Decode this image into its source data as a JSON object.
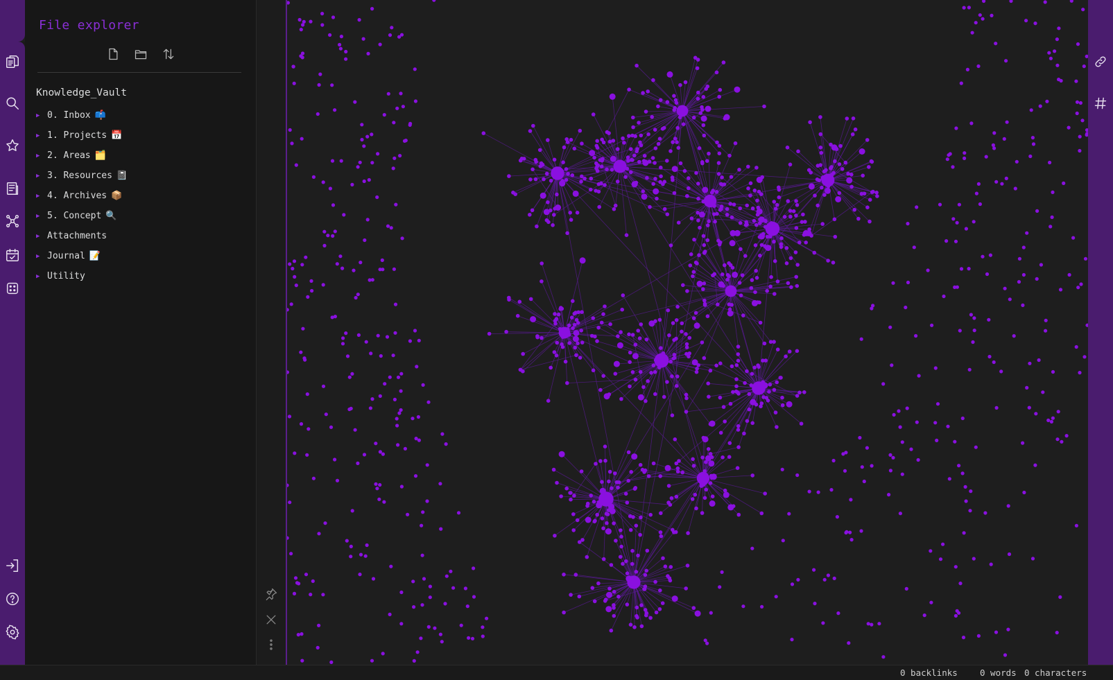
{
  "colors": {
    "accent": "#8a2fd6",
    "ribbon": "#4a1c6e",
    "node": "#8a10e0",
    "edge": "#5a1a96",
    "background": "#1e1e1e"
  },
  "ribbon_left": {
    "icons": [
      "file-explorer-icon",
      "search-icon",
      "starred-icon",
      "templates-icon",
      "graph-view-icon",
      "daily-note-icon",
      "random-note-icon",
      "open-vault-icon",
      "help-icon",
      "settings-icon"
    ]
  },
  "sidebar": {
    "title": "File explorer",
    "toolbar": [
      "new-note-icon",
      "new-folder-icon",
      "sort-icon"
    ],
    "vault_name": "Knowledge_Vault",
    "items": [
      {
        "label": "0. Inbox",
        "emoji": "📫"
      },
      {
        "label": "1. Projects",
        "emoji": "📅"
      },
      {
        "label": "2. Areas",
        "emoji": "🗂️"
      },
      {
        "label": "3. Resources",
        "emoji": "📓"
      },
      {
        "label": "4. Archives",
        "emoji": "📦"
      },
      {
        "label": "5. Concept",
        "emoji": "🔍"
      },
      {
        "label": "Attachments",
        "emoji": ""
      },
      {
        "label": "Journal",
        "emoji": "📝"
      },
      {
        "label": "Utility",
        "emoji": ""
      }
    ]
  },
  "side_actions": [
    "pin-icon",
    "close-icon",
    "more-options-icon"
  ],
  "ribbon_right": {
    "icons": [
      "backlinks-icon",
      "tags-icon"
    ]
  },
  "status_bar": {
    "backlinks": "0 backlinks",
    "words": "0 words",
    "characters": "0 characters"
  }
}
